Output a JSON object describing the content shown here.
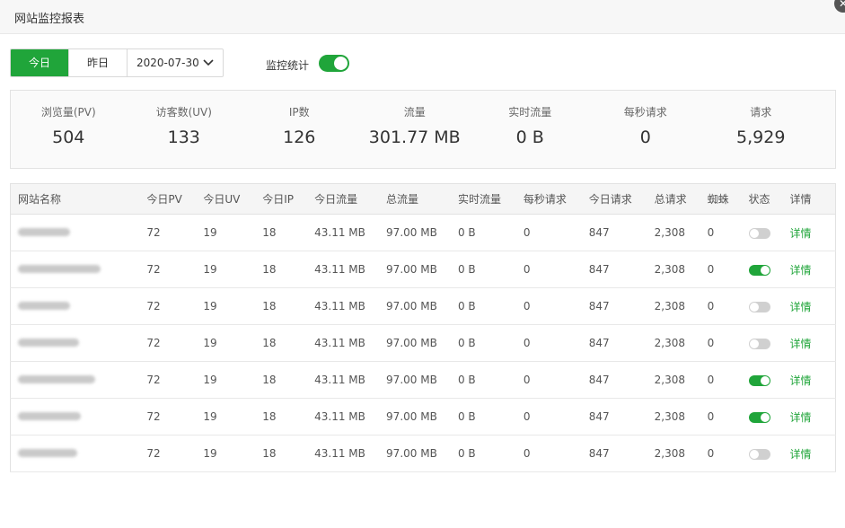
{
  "window": {
    "title": "网站监控报表",
    "close_icon": "✕"
  },
  "filter": {
    "today_label": "今日",
    "yesterday_label": "昨日",
    "date_value": "2020-07-30",
    "chevron": "⌄",
    "active_color": "#20a53a"
  },
  "monitor_toggle": {
    "label": "监控统计",
    "on": true
  },
  "stats": [
    {
      "label": "浏览量(PV)",
      "value": "504"
    },
    {
      "label": "访客数(UV)",
      "value": "133"
    },
    {
      "label": "IP数",
      "value": "126"
    },
    {
      "label": "流量",
      "value": "301.77 MB"
    },
    {
      "label": "实时流量",
      "value": "0 B"
    },
    {
      "label": "每秒请求",
      "value": "0"
    },
    {
      "label": "请求",
      "value": "5,929"
    }
  ],
  "table": {
    "headers": [
      "网站名称",
      "今日PV",
      "今日UV",
      "今日IP",
      "今日流量",
      "总流量",
      "实时流量",
      "每秒请求",
      "今日请求",
      "总请求",
      "蜘蛛",
      "状态",
      "详情"
    ],
    "rows": [
      {
        "pv": "72",
        "uv": "19",
        "ip": "18",
        "today_traffic": "43.11 MB",
        "total_traffic": "97.00 MB",
        "realtime": "0 B",
        "rps": "0",
        "today_req": "847",
        "total_req": "2,308",
        "spider": "0",
        "status_on": false,
        "detail": "详情"
      },
      {
        "pv": "72",
        "uv": "19",
        "ip": "18",
        "today_traffic": "43.11 MB",
        "total_traffic": "97.00 MB",
        "realtime": "0 B",
        "rps": "0",
        "today_req": "847",
        "total_req": "2,308",
        "spider": "0",
        "status_on": true,
        "detail": "详情"
      },
      {
        "pv": "72",
        "uv": "19",
        "ip": "18",
        "today_traffic": "43.11 MB",
        "total_traffic": "97.00 MB",
        "realtime": "0 B",
        "rps": "0",
        "today_req": "847",
        "total_req": "2,308",
        "spider": "0",
        "status_on": false,
        "detail": "详情"
      },
      {
        "pv": "72",
        "uv": "19",
        "ip": "18",
        "today_traffic": "43.11 MB",
        "total_traffic": "97.00 MB",
        "realtime": "0 B",
        "rps": "0",
        "today_req": "847",
        "total_req": "2,308",
        "spider": "0",
        "status_on": false,
        "detail": "详情"
      },
      {
        "pv": "72",
        "uv": "19",
        "ip": "18",
        "today_traffic": "43.11 MB",
        "total_traffic": "97.00 MB",
        "realtime": "0 B",
        "rps": "0",
        "today_req": "847",
        "total_req": "2,308",
        "spider": "0",
        "status_on": true,
        "detail": "详情"
      },
      {
        "pv": "72",
        "uv": "19",
        "ip": "18",
        "today_traffic": "43.11 MB",
        "total_traffic": "97.00 MB",
        "realtime": "0 B",
        "rps": "0",
        "today_req": "847",
        "total_req": "2,308",
        "spider": "0",
        "status_on": true,
        "detail": "详情"
      },
      {
        "pv": "72",
        "uv": "19",
        "ip": "18",
        "today_traffic": "43.11 MB",
        "total_traffic": "97.00 MB",
        "realtime": "0 B",
        "rps": "0",
        "today_req": "847",
        "total_req": "2,308",
        "spider": "0",
        "status_on": false,
        "detail": "详情"
      }
    ]
  }
}
